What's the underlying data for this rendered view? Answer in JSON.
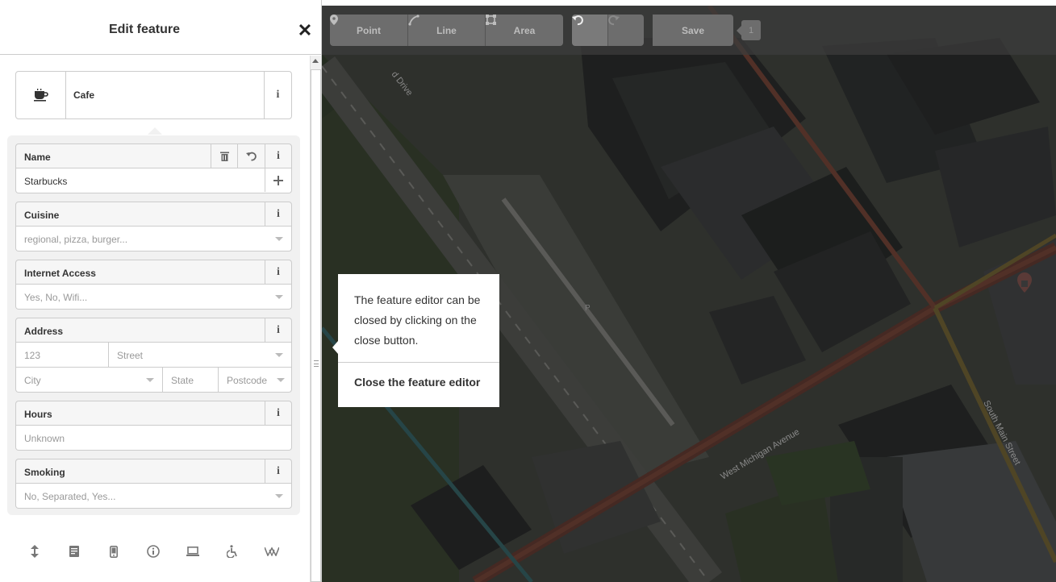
{
  "sidebar": {
    "title": "Edit feature",
    "close_icon": "close-icon",
    "preset": {
      "label": "Cafe",
      "icon": "cafe-cup-icon"
    },
    "fields": {
      "name": {
        "label": "Name",
        "value": "Starbucks"
      },
      "cuisine": {
        "label": "Cuisine",
        "placeholder": "regional, pizza, burger..."
      },
      "internet": {
        "label": "Internet Access",
        "placeholder": "Yes, No, Wifi..."
      },
      "address": {
        "label": "Address",
        "housenumber": "123",
        "street": "Street",
        "city": "City",
        "state": "State",
        "postcode": "Postcode"
      },
      "hours": {
        "label": "Hours",
        "placeholder": "Unknown"
      },
      "smoking": {
        "label": "Smoking",
        "placeholder": "No, Separated, Yes..."
      }
    },
    "bottom_icons": [
      "expand-vertical-icon",
      "note-icon",
      "mobile-icon",
      "info-circle-icon",
      "laptop-icon",
      "wheelchair-icon",
      "wikipedia-icon"
    ]
  },
  "toolbar": {
    "point": "Point",
    "line": "Line",
    "area": "Area",
    "save": "Save",
    "count": "1"
  },
  "tooltip": {
    "text": "The feature editor can be closed by clicking on the close button.",
    "action": "Close the feature editor"
  },
  "map": {
    "labels": {
      "drive": "d Drive",
      "west_michigan": "West Michigan Avenue",
      "south_main": "South Main Street",
      "parking": "P"
    }
  }
}
